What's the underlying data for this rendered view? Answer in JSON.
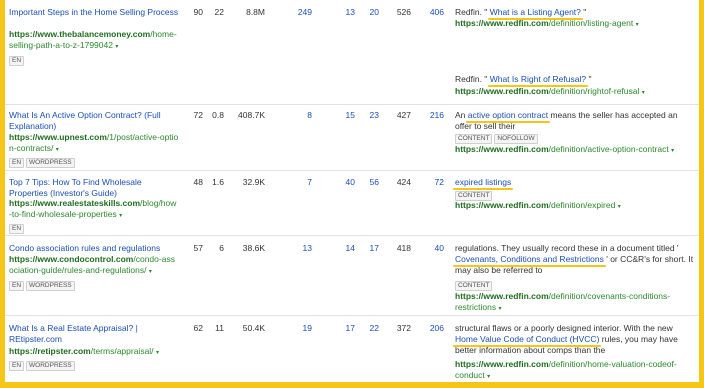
{
  "rows": [
    {
      "title": "Important Steps in the Home Selling Process",
      "url_domain": "https://www.thebalancemoney.com",
      "url_path": "/home-selling-path-a-to-z-1799042",
      "tags": [
        "EN"
      ],
      "dr": "90",
      "ur": "22",
      "traffic": "8.8M",
      "referring_domains": "249",
      "linked_domains": "13",
      "external": "20",
      "dofollow": "526",
      "total": "406",
      "snippets": [
        {
          "pre": "Redfin. \" ",
          "anchor": "What is a Listing Agent?",
          "post": " \"",
          "target_domain": "https://www.redfin.com",
          "target_path": "/definition/listing-agent",
          "tags": []
        },
        {
          "pre": "Redfin. \" ",
          "anchor": "What Is Right of Refusal?",
          "post": " \"",
          "target_domain": "https://www.redfin.com",
          "target_path": "/definition/rightof-refusal",
          "tags": []
        }
      ]
    },
    {
      "title": "What Is An Active Option Contract? (Full Explanation)",
      "url_domain": "https://www.upnest.com",
      "url_path": "/1/post/active-option-contracts/",
      "tags": [
        "EN",
        "WORDPRESS"
      ],
      "dr": "72",
      "ur": "0.8",
      "traffic": "408.7K",
      "referring_domains": "8",
      "linked_domains": "15",
      "external": "23",
      "dofollow": "427",
      "total": "216",
      "snippets": [
        {
          "pre": "An ",
          "anchor": "active option contract",
          "post": " means the seller has accepted an offer to sell their",
          "target_domain": "https://www.redfin.com",
          "target_path": "/definition/active-option-contract",
          "tags": [
            "CONTENT",
            "NOFOLLOW"
          ]
        }
      ]
    },
    {
      "title": "Top 7 Tips: How To Find Wholesale Properties (Investor's Guide)",
      "url_domain": "https://www.realestateskills.com",
      "url_path": "/blog/how-to-find-wholesale-properties",
      "tags": [
        "EN"
      ],
      "dr": "48",
      "ur": "1.6",
      "traffic": "32.9K",
      "referring_domains": "7",
      "linked_domains": "40",
      "external": "56",
      "dofollow": "424",
      "total": "72",
      "snippets": [
        {
          "pre": "",
          "anchor": "expired listings",
          "post": "",
          "target_domain": "https://www.redfin.com",
          "target_path": "/definition/expired",
          "tags": [
            "CONTENT"
          ]
        }
      ]
    },
    {
      "title": "Condo association rules and regulations",
      "url_domain": "https://www.condocontrol.com",
      "url_path": "/condo-association-guide/rules-and-regulations/",
      "tags": [
        "EN",
        "WORDPRESS"
      ],
      "dr": "57",
      "ur": "6",
      "traffic": "38.6K",
      "referring_domains": "13",
      "linked_domains": "14",
      "external": "17",
      "dofollow": "418",
      "total": "40",
      "snippets": [
        {
          "pre": "regulations. They usually record these in a document titled ' ",
          "anchor": "Covenants, Conditions and Restrictions",
          "post": " ' or CC&R's for short. It may also be referred to",
          "target_domain": "https://www.redfin.com",
          "target_path": "/definition/covenants-conditions-restrictions",
          "tags": [
            "CONTENT"
          ]
        }
      ]
    },
    {
      "title": "What Is a Real Estate Appraisal? | REtipster.com",
      "url_domain": "https://retipster.com",
      "url_path": "/terms/appraisal/",
      "tags": [
        "EN",
        "WORDPRESS"
      ],
      "dr": "62",
      "ur": "11",
      "traffic": "50.4K",
      "referring_domains": "19",
      "linked_domains": "17",
      "external": "22",
      "dofollow": "372",
      "total": "206",
      "snippets": [
        {
          "pre": "structural flaws or a poorly designed interior. With the new ",
          "anchor": "Home Value Code of Conduct (HVCC)",
          "post": " rules, you may have better information about comps than the",
          "target_domain": "https://www.redfin.com",
          "target_path": "/definition/home-valuation-codeof-conduct",
          "tags": []
        }
      ]
    }
  ],
  "caret_glyph": "▾"
}
